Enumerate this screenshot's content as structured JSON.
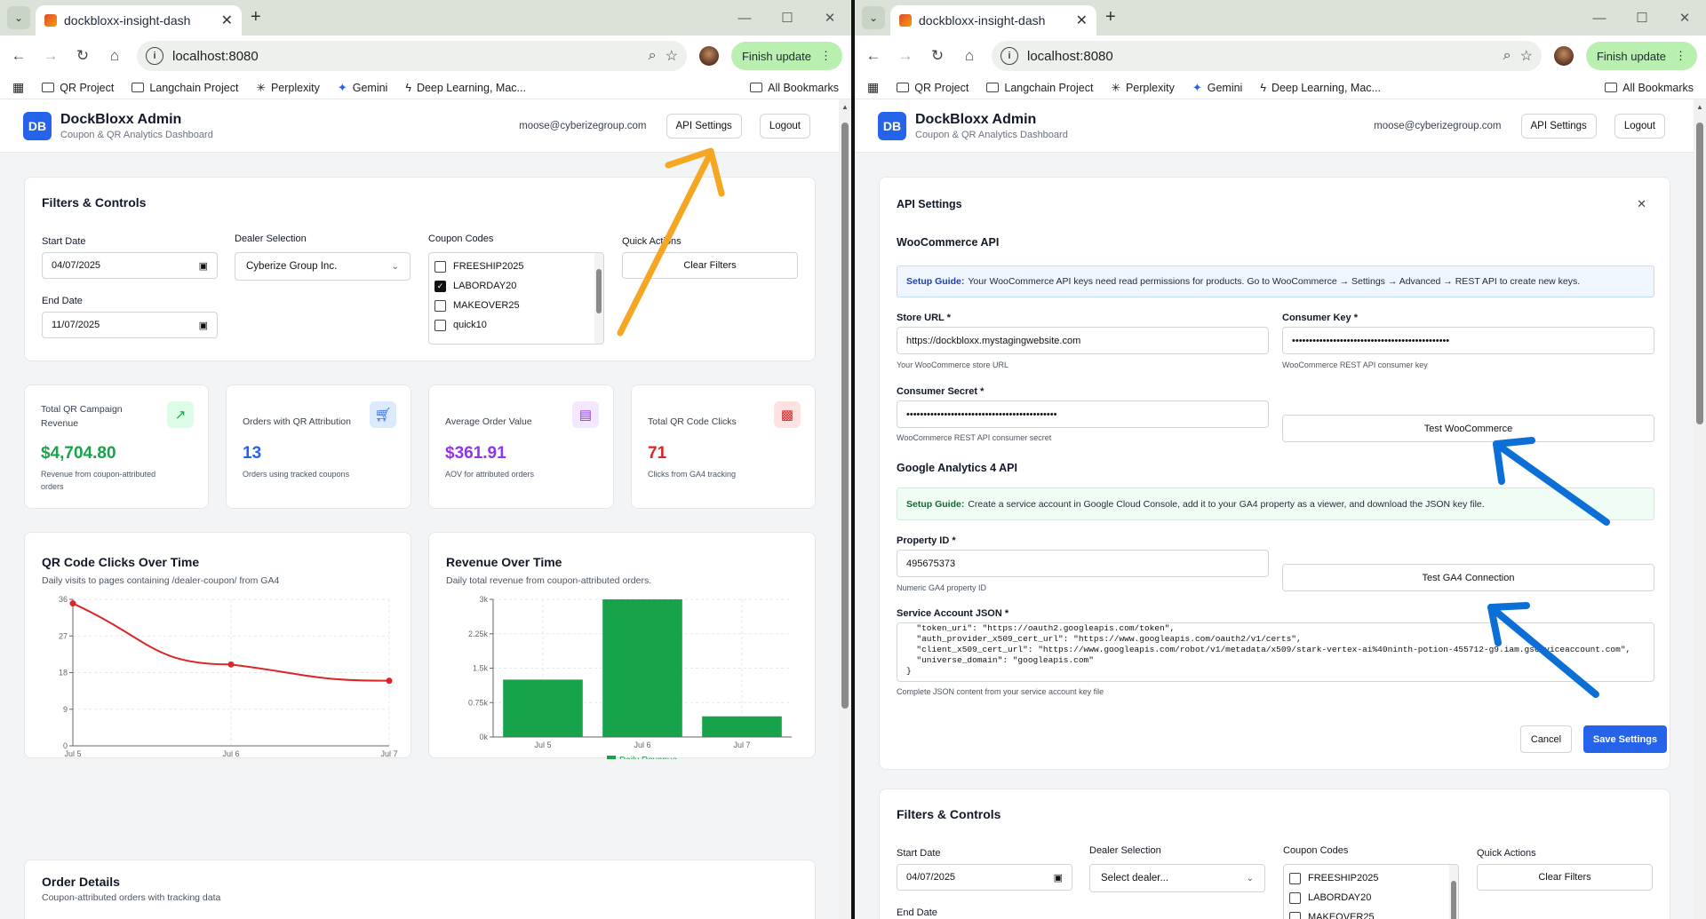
{
  "browser": {
    "tab_title": "dockbloxx-insight-dash",
    "url": "localhost:8080",
    "finish_update": "Finish update",
    "bookmarks": [
      "QR Project",
      "Langchain Project",
      "Perplexity",
      "Gemini",
      "Deep Learning, Mac..."
    ],
    "all_bookmarks": "All Bookmarks"
  },
  "header": {
    "logo": "DB",
    "title": "DockBloxx Admin",
    "subtitle": "Coupon & QR Analytics Dashboard",
    "email": "moose@cyberizegroup.com",
    "api_settings": "API Settings",
    "logout": "Logout"
  },
  "filters": {
    "title": "Filters & Controls",
    "start_date_label": "Start Date",
    "start_date": "04/07/2025",
    "end_date_label": "End Date",
    "end_date": "11/07/2025",
    "dealer_label": "Dealer Selection",
    "dealer_value": "Cyberize Group Inc.",
    "dealer_placeholder": "Select dealer...",
    "coupon_label": "Coupon Codes",
    "coupons": [
      {
        "code": "FREESHIP2025",
        "checked": false
      },
      {
        "code": "LABORDAY20",
        "checked": true
      },
      {
        "code": "MAKEOVER25",
        "checked": false
      },
      {
        "code": "quick10",
        "checked": false
      }
    ],
    "coupons_right": [
      {
        "code": "FREESHIP2025",
        "checked": false
      },
      {
        "code": "LABORDAY20",
        "checked": false
      },
      {
        "code": "MAKEOVER25",
        "checked": false
      }
    ],
    "quick_actions_label": "Quick Actions",
    "clear_filters": "Clear Filters"
  },
  "kpis": [
    {
      "title": "Total QR Campaign Revenue",
      "value": "$4,704.80",
      "desc": "Revenue from coupon-attributed orders",
      "color": "#16a34a",
      "icon": "trending-up-icon"
    },
    {
      "title": "Orders with QR Attribution",
      "value": "13",
      "desc": "Orders using tracked coupons",
      "color": "#2563eb",
      "icon": "cart-icon"
    },
    {
      "title": "Average Order Value",
      "value": "$361.91",
      "desc": "AOV for attributed orders",
      "color": "#9333ea",
      "icon": "document-icon"
    },
    {
      "title": "Total QR Code Clicks",
      "value": "71",
      "desc": "Clicks from GA4 tracking",
      "color": "#dc2626",
      "icon": "qr-icon"
    }
  ],
  "clicks_chart": {
    "title": "QR Code Clicks Over Time",
    "subtitle": "Daily visits to pages containing /dealer-coupon/ from GA4"
  },
  "revenue_chart": {
    "title": "Revenue Over Time",
    "subtitle": "Daily total revenue from coupon-attributed orders."
  },
  "chart_data": [
    {
      "type": "line",
      "title": "QR Code Clicks Over Time",
      "x": [
        "Jul 5",
        "Jul 6",
        "Jul 7"
      ],
      "series": [
        {
          "values": [
            35,
            20,
            16
          ]
        }
      ],
      "yticks": [
        "0",
        "9",
        "18",
        "27",
        "36"
      ],
      "ylim": [
        0,
        36
      ],
      "color": "#dc2626"
    },
    {
      "type": "bar",
      "title": "Revenue Over Time",
      "categories": [
        "Jul 5",
        "Jul 6",
        "Jul 7"
      ],
      "series": [
        {
          "name": "Daily Revenue",
          "values": [
            1250,
            3000,
            450
          ]
        }
      ],
      "yticks": [
        "0k",
        "0.75k",
        "1.5k",
        "2.25k",
        "3k"
      ],
      "ylim": [
        0,
        3000
      ],
      "color": "#16a34a"
    }
  ],
  "orders": {
    "title": "Order Details",
    "subtitle": "Coupon-attributed orders with tracking data"
  },
  "api_modal": {
    "title": "API Settings",
    "woo_title": "WooCommerce API",
    "woo_guide_bold": "Setup Guide:",
    "woo_guide": "Your WooCommerce API keys need read permissions for products. Go to WooCommerce → Settings → Advanced → REST API to create new keys.",
    "store_url_label": "Store URL *",
    "store_url": "https://dockbloxx.mystagingwebsite.com",
    "store_url_hint": "Your WooCommerce store URL",
    "consumer_key_label": "Consumer Key *",
    "consumer_key": "••••••••••••••••••••••••••••••••••••••••••••••",
    "consumer_key_hint": "WooCommerce REST API consumer key",
    "consumer_secret_label": "Consumer Secret *",
    "consumer_secret": "••••••••••••••••••••••••••••••••••••••••••••",
    "consumer_secret_hint": "WooCommerce REST API consumer secret",
    "test_woo": "Test WooCommerce",
    "ga_title": "Google Analytics 4 API",
    "ga_guide_bold": "Setup Guide:",
    "ga_guide": "Create a service account in Google Cloud Console, add it to your GA4 property as a viewer, and download the JSON key file.",
    "property_label": "Property ID *",
    "property_id": "495675373",
    "property_hint": "Numeric GA4 property ID",
    "test_ga": "Test GA4 Connection",
    "sa_label": "Service Account JSON *",
    "sa_json": "  \"token_uri\": \"https://oauth2.googleapis.com/token\",\n  \"auth_provider_x509_cert_url\": \"https://www.googleapis.com/oauth2/v1/certs\",\n  \"client_x509_cert_url\": \"https://www.googleapis.com/robot/v1/metadata/x509/stark-vertex-ai%40ninth-potion-455712-g9.iam.gserviceaccount.com\",\n  \"universe_domain\": \"googleapis.com\"\n}",
    "sa_hint": "Complete JSON content from your service account key file",
    "cancel": "Cancel",
    "save": "Save Settings"
  }
}
